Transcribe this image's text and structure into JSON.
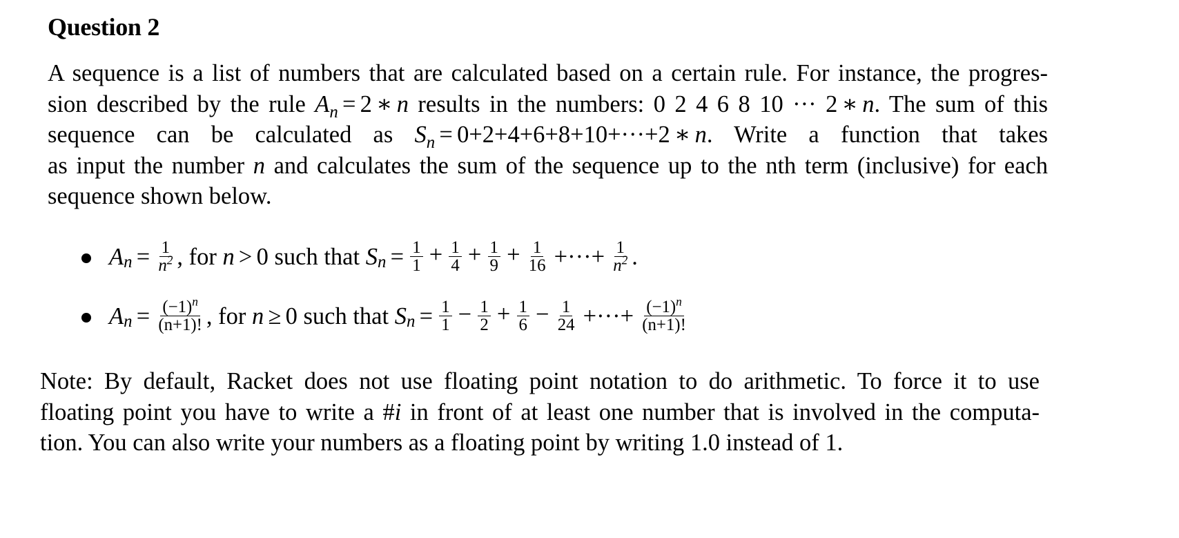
{
  "heading": "Question 2",
  "intro": {
    "line1": {
      "text": "A sequence is a list of numbers that are calculated based on a certain rule. For instance, the progres-"
    },
    "line2": {
      "pre": "sion described by the rule ",
      "A": "A",
      "n": "n",
      "eq": "=",
      "expr_a": "2",
      "star": "∗",
      "expr_n": "n",
      "mid": " results in the numbers: 0 2 4 6 8 10 ",
      "dots": "···",
      "tail_2": " 2",
      "tail_star": "∗",
      "tail_n": "n",
      "post": ". The sum of this"
    },
    "line3": {
      "pre": "sequence can be calculated as ",
      "S": "S",
      "n": "n",
      "eq": "=",
      "sum": "0+2+4+6+8+10+···+2",
      "star": "∗",
      "sum_n": "n",
      "post": ". Write a function that takes"
    },
    "line4": {
      "pre": "as input the number ",
      "n": "n",
      "post": " and calculates the sum of the sequence up to the nth term (inclusive) for each"
    },
    "line5": {
      "text": "sequence shown below."
    }
  },
  "sequences": [
    {
      "A": "A",
      "n": "n",
      "eq": "=",
      "def_num": "1",
      "def_den_base": "n",
      "def_den_exp": "2",
      "condition_pre": ", for ",
      "condition_var": "n",
      "condition_op": ">",
      "condition_val": "0",
      "condition_post": " such that ",
      "S": "S",
      "Sn": "n",
      "terms": [
        {
          "sign": "",
          "num": "1",
          "den": "1"
        },
        {
          "sign": "+",
          "num": "1",
          "den": "4"
        },
        {
          "sign": "+",
          "num": "1",
          "den": "9"
        },
        {
          "sign": "+",
          "num": "1",
          "den": "16"
        }
      ],
      "ellipsis": "+···+",
      "last_num": "1",
      "last_den_base": "n",
      "last_den_exp": "2",
      "end": "."
    },
    {
      "A": "A",
      "n": "n",
      "eq": "=",
      "def_num": "(−1)",
      "def_num_exp": "n",
      "def_den": "(n+1)!",
      "condition_pre": ", for ",
      "condition_var": "n",
      "condition_op": "≥",
      "condition_val": "0",
      "condition_post": " such that ",
      "S": "S",
      "Sn": "n",
      "terms": [
        {
          "sign": "",
          "num": "1",
          "den": "1"
        },
        {
          "sign": "−",
          "num": "1",
          "den": "2"
        },
        {
          "sign": "+",
          "num": "1",
          "den": "6"
        },
        {
          "sign": "−",
          "num": "1",
          "den": "24"
        }
      ],
      "ellipsis": "+···+",
      "last_num": "(−1)",
      "last_num_exp": "n",
      "last_den": "(n+1)!",
      "end": ""
    }
  ],
  "note": {
    "line1": "Note: By default, Racket does not use floating point notation to do arithmetic. To force it to use",
    "line2_pre": "floating point you have to write a #",
    "line2_i": "i",
    "line2_post": " in front of at least one number that is involved in the computa-",
    "line3": "tion. You can also write your numbers as a floating point by writing 1.0 instead of 1."
  }
}
